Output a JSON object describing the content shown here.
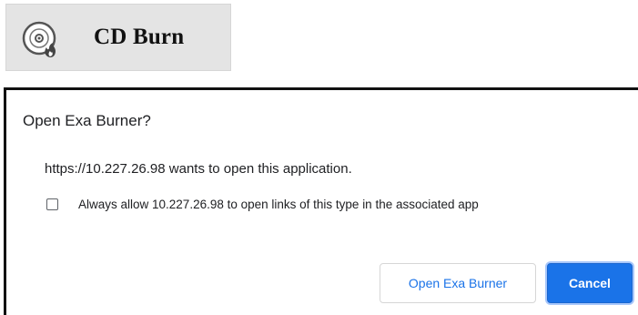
{
  "toolbar": {
    "cd_burn_label": "CD Burn",
    "cd_burn_icon": "cd-burn-icon"
  },
  "dialog": {
    "title": "Open Exa Burner?",
    "message": "https://10.227.26.98 wants to open this application.",
    "checkbox_label": "Always allow 10.227.26.98 to open links of this type in the associated app",
    "checkbox_checked": false,
    "open_button_label": "Open Exa Burner",
    "cancel_button_label": "Cancel"
  },
  "colors": {
    "accent": "#1a73e8",
    "toolbar_bg": "#e4e4e4",
    "text": "#202124"
  }
}
